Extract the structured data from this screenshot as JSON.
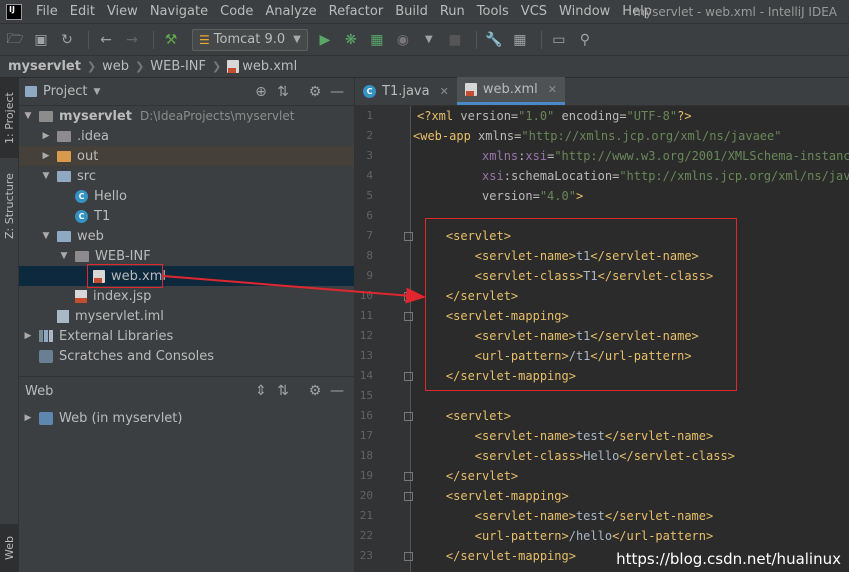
{
  "menu": {
    "items": [
      "File",
      "Edit",
      "View",
      "Navigate",
      "Code",
      "Analyze",
      "Refactor",
      "Build",
      "Run",
      "Tools",
      "VCS",
      "Window",
      "Help"
    ],
    "window_title": "myservlet - web.xml - IntelliJ IDEA"
  },
  "toolbar": {
    "run_config": "Tomcat 9.0"
  },
  "breadcrumb": {
    "items": [
      "myservlet",
      "web",
      "WEB-INF",
      "web.xml"
    ]
  },
  "left_stripe": {
    "project_tab": "1: Project",
    "structure_tab": "Z: Structure",
    "web_tab": "Web"
  },
  "project_panel": {
    "title": "Project",
    "tree": [
      {
        "label": "myservlet",
        "path": "D:\\IdeaProjects\\myservlet",
        "icon": "folder-icon"
      },
      {
        "label": ".idea",
        "icon": "folder-icon"
      },
      {
        "label": "out",
        "icon": "folder-icon"
      },
      {
        "label": "src",
        "icon": "folder-icon"
      },
      {
        "label": "Hello",
        "icon": "class-icon"
      },
      {
        "label": "T1",
        "icon": "class-icon"
      },
      {
        "label": "web",
        "icon": "folder-icon"
      },
      {
        "label": "WEB-INF",
        "icon": "folder-icon"
      },
      {
        "label": "web.xml",
        "icon": "xml-file-icon"
      },
      {
        "label": "index.jsp",
        "icon": "jsp-file-icon"
      },
      {
        "label": "myservlet.iml",
        "icon": "iml-file-icon"
      },
      {
        "label": "External Libraries",
        "icon": "libraries-icon"
      },
      {
        "label": "Scratches and Consoles",
        "icon": "scratches-icon"
      }
    ]
  },
  "web_panel": {
    "title": "Web",
    "item": "Web (in myservlet)"
  },
  "editor": {
    "tabs": [
      {
        "label": "T1.java",
        "active": false
      },
      {
        "label": "web.xml",
        "active": true
      }
    ],
    "line_numbers": [
      "1",
      "2",
      "3",
      "4",
      "5",
      "6",
      "7",
      "8",
      "9",
      "10",
      "11",
      "12",
      "13",
      "14",
      "15",
      "16",
      "17",
      "18",
      "19",
      "20",
      "21",
      "22",
      "23"
    ]
  },
  "watermark": "https://blog.csdn.net/hualinux",
  "colors": {
    "accent": "#4a88c7",
    "highlight_red": "#e0272f",
    "tag": "#e8bf6a",
    "string": "#6a8759"
  }
}
